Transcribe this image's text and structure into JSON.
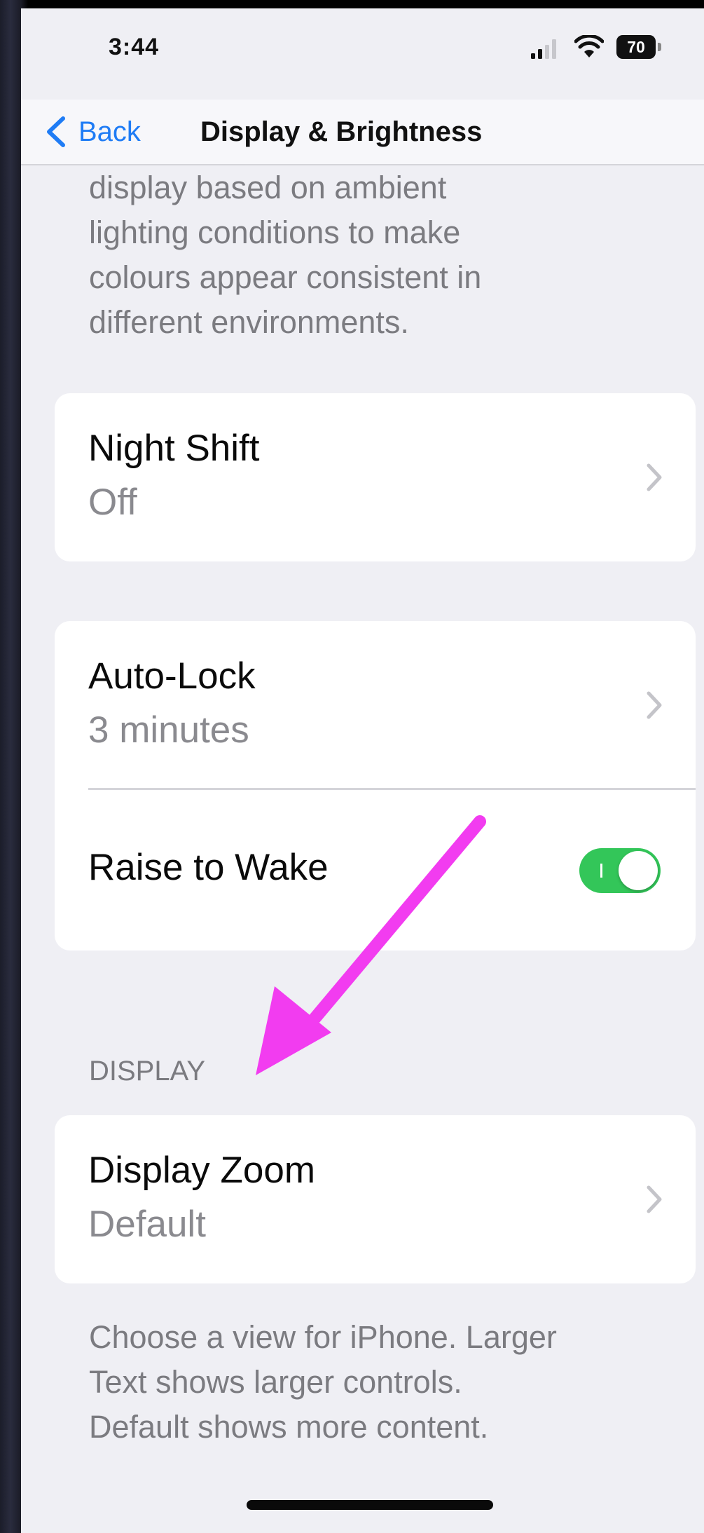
{
  "status_bar": {
    "time": "3:44",
    "battery": "70",
    "icons": [
      "signal-icon",
      "wifi-icon",
      "battery-icon"
    ]
  },
  "nav": {
    "back_label": "Back",
    "title": "Display & Brightness"
  },
  "truetone_description": [
    "display based on ambient",
    "lighting conditions to make",
    "colours appear consistent in",
    "different environments."
  ],
  "night_shift": {
    "title": "Night Shift",
    "value": "Off"
  },
  "auto_lock": {
    "title": "Auto-Lock",
    "value": "3 minutes"
  },
  "raise_to_wake": {
    "title": "Raise to Wake",
    "enabled": true
  },
  "display_section": {
    "header": "DISPLAY"
  },
  "display_zoom": {
    "title": "Display Zoom",
    "value": "Default"
  },
  "display_zoom_footer": [
    "Choose a view for iPhone. Larger",
    "Text shows larger controls.",
    "Default shows more content."
  ],
  "colors": {
    "accent_blue": "#1f7cf5",
    "toggle_green": "#33c659",
    "arrow_magenta": "#f23cf0"
  }
}
